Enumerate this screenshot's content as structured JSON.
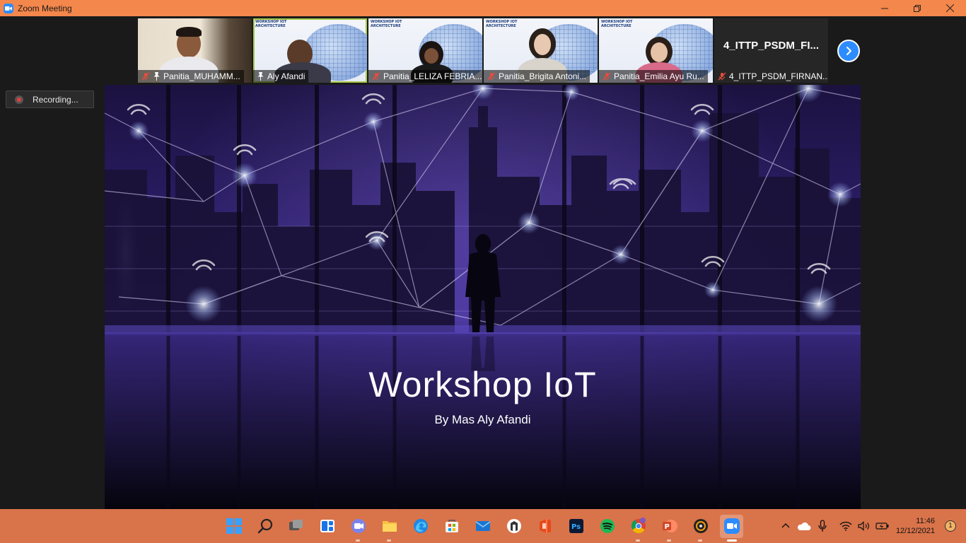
{
  "window": {
    "title": "Zoom Meeting"
  },
  "participants": [
    {
      "name": "Panitia_MUHAMM...",
      "type": "camera"
    },
    {
      "name": "Aly Afandi",
      "type": "camera",
      "active": true
    },
    {
      "name": "Panitia_LELIZA FEBRIA...",
      "type": "camera"
    },
    {
      "name": "Panitia_Brigita Antoni...",
      "type": "camera"
    },
    {
      "name": "Panitia_Emilia Ayu Ru...",
      "type": "camera"
    },
    {
      "name": "4_ITTP_PSDM_FIRNAN...",
      "type": "nocam",
      "display_name": "4_ITTP_PSDM_FI..."
    }
  ],
  "thumb_slide_header": "WORKSHOP IOT ARCHITECTURE",
  "recording": {
    "label": "Recording..."
  },
  "shared_slide": {
    "title": "Workshop IoT",
    "subtitle": "By Mas Aly Afandi"
  },
  "taskbar": {
    "clock_time": "11:46",
    "clock_date": "12/12/2021",
    "notification_count": "1"
  },
  "colors": {
    "titlebar": "#f4874b",
    "taskbar": "#d9734a",
    "zoom_blue": "#2d8cff",
    "active_speaker": "#a6c94a"
  }
}
